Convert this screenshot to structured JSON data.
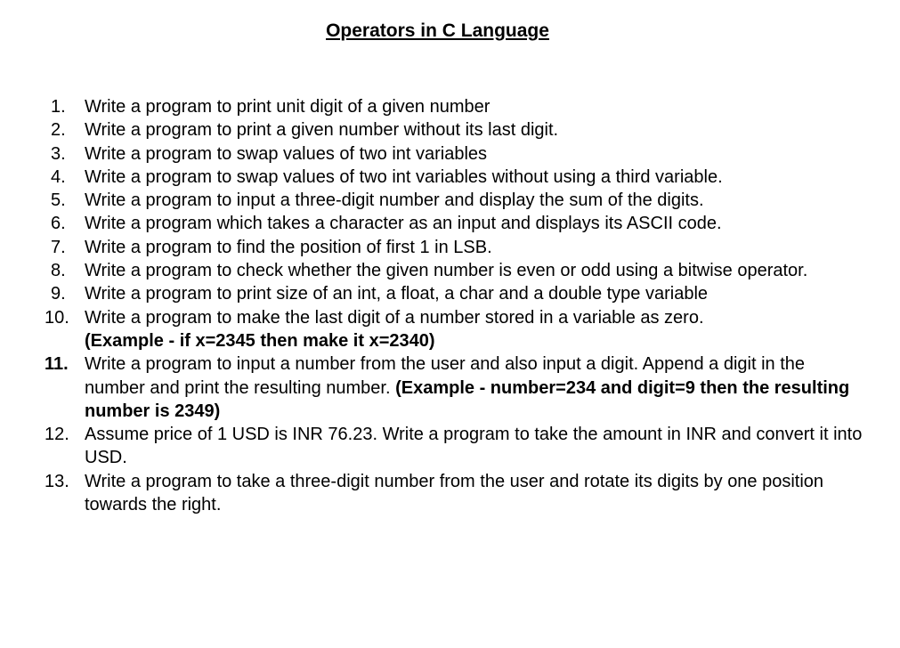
{
  "document": {
    "title": "Operators in C Language",
    "questions": [
      {
        "number": "1.",
        "text": "Write a program to print unit digit of a given number"
      },
      {
        "number": "2.",
        "text": "Write a program to print a given number without its last digit."
      },
      {
        "number": "3.",
        "text": "Write a program to swap values of two int variables"
      },
      {
        "number": "4.",
        "text": "Write a program to swap values of two int variables without using a third variable."
      },
      {
        "number": "5.",
        "text": "Write a program to input a three-digit number and display the sum of the digits."
      },
      {
        "number": "6.",
        "text": "Write a program which takes a character as an input and displays its ASCII code."
      },
      {
        "number": "7.",
        "text": "Write a program to find the position of first 1 in LSB."
      },
      {
        "number": "8.",
        "text": "Write a program to check whether the given number is even or odd using a bitwise operator."
      },
      {
        "number": "9.",
        "text": "Write a program to print size of an int, a float, a char and a double type variable"
      },
      {
        "number": "10.",
        "text": "Write a program to make the last digit of a number stored in a variable as zero.",
        "example": "(Example - if x=2345 then make it x=2340)"
      },
      {
        "number": "11.",
        "text": "Write a program to input a number from the user and also input a digit. Append a digit in the number and print the resulting number.",
        "example": "(Example - number=234 and digit=9 then the resulting number is 2349)"
      },
      {
        "number": "12.",
        "text": "Assume price of 1 USD is INR 76.23. Write a program to take the amount in INR and convert it into USD."
      },
      {
        "number": "13.",
        "text": "Write a program to take a three-digit number from the user and rotate its digits by one position towards the right."
      }
    ]
  }
}
